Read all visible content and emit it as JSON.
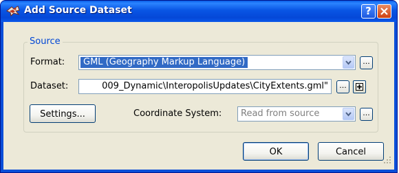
{
  "window": {
    "title": "Add Source Dataset",
    "icon": "fme-dataset-icon",
    "help_label": "?",
    "close_label": "X"
  },
  "source_group": {
    "legend": "Source",
    "format_label": "Format:",
    "format_value": "GML (Geography Markup Language)",
    "format_browse_label": "...",
    "dataset_label": "Dataset:",
    "dataset_value": "009_Dynamic\\InteropolisUpdates\\CityExtents.gml\"",
    "dataset_browse_label": "...",
    "settings_label": "Settings...",
    "coord_label": "Coordinate System:",
    "coord_value": "Read from source",
    "coord_browse_label": "..."
  },
  "buttons": {
    "ok_label": "OK",
    "cancel_label": "Cancel"
  }
}
